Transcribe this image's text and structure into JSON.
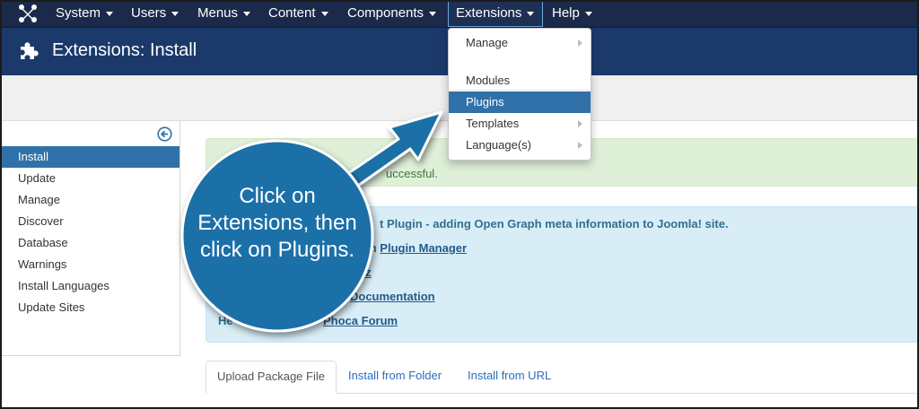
{
  "nav": {
    "items": [
      {
        "label": "System"
      },
      {
        "label": "Users"
      },
      {
        "label": "Menus"
      },
      {
        "label": "Content"
      },
      {
        "label": "Components"
      },
      {
        "label": "Extensions"
      },
      {
        "label": "Help"
      }
    ],
    "active": "Extensions"
  },
  "header": {
    "title": "Extensions: Install",
    "icon": "puzzle-icon"
  },
  "sidebar": {
    "items": [
      {
        "label": "Install"
      },
      {
        "label": "Update"
      },
      {
        "label": "Manage"
      },
      {
        "label": "Discover"
      },
      {
        "label": "Database"
      },
      {
        "label": "Warnings"
      },
      {
        "label": "Install Languages"
      },
      {
        "label": "Update Sites"
      }
    ],
    "active": "Install"
  },
  "dropdown": {
    "items": [
      {
        "label": "Manage",
        "submenu": true
      },
      {
        "label": "Modules",
        "submenu": false
      },
      {
        "label": "Plugins",
        "submenu": false
      },
      {
        "label": "Templates",
        "submenu": true
      },
      {
        "label": "Language(s)",
        "submenu": true
      }
    ],
    "active": "Plugins"
  },
  "alert_success": {
    "message": "uccessful."
  },
  "alert_info": {
    "line1": "t Plugin - adding Open Graph meta information to Joomla! site.",
    "line2_prefix": "gin in ",
    "line2_link": "Plugin Manager",
    "line3_link": "cz",
    "line4_link": "Documentation",
    "line5_prefix": "He",
    "line5_link": "Phoca Forum"
  },
  "tabs": [
    {
      "label": "Upload Package File"
    },
    {
      "label": "Install from Folder"
    },
    {
      "label": "Install from URL"
    }
  ],
  "callout": {
    "text": "Click on Extensions, then click on Plugins."
  },
  "colors": {
    "navbar": "#1b2a4a",
    "header": "#1b3a6b",
    "active_item": "#3071a9",
    "callout": "#1f6fa8"
  }
}
